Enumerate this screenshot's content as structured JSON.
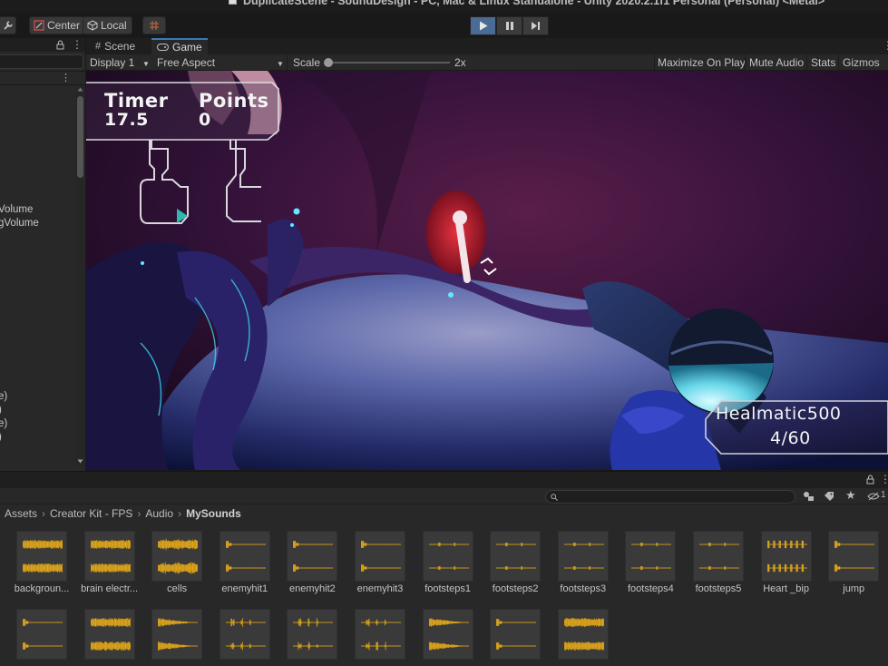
{
  "window": {
    "title": "DuplicateScene - SoundDesign - PC, Mac & Linux Standalone - Unity 2020.2.1f1 Personal (Personal) <Metal>"
  },
  "toolbar": {
    "pivot_label": "Center",
    "space_label": "Local"
  },
  "hierarchy": {
    "rows": [
      "Volume",
      "gVolume",
      "e)",
      ")",
      "e)",
      ")"
    ]
  },
  "tabs": [
    {
      "label": "Scene",
      "icon": "grid-icon",
      "active": false
    },
    {
      "label": "Game",
      "icon": "gamepad-icon",
      "active": true
    }
  ],
  "game_toolbar": {
    "display": "Display 1",
    "aspect": "Free Aspect",
    "scale_label": "Scale",
    "scale_value": "2x",
    "scale_slider_fraction": 0.0,
    "maximize": "Maximize On Play",
    "mute": "Mute Audio",
    "stats": "Stats",
    "gizmos": "Gizmos"
  },
  "hud": {
    "timer_label": "Timer",
    "timer_value": "17.5",
    "points_label": "Points",
    "points_value": "0",
    "weapon_name": "Healmatic500",
    "ammo": "4/60"
  },
  "project": {
    "breadcrumb": [
      "Assets",
      "Creator Kit - FPS",
      "Audio",
      "MySounds"
    ],
    "assets": [
      {
        "name": "backgroun...",
        "wave": "dense"
      },
      {
        "name": "brain electr...",
        "wave": "dense"
      },
      {
        "name": "cells",
        "wave": "burst"
      },
      {
        "name": "enemyhit1",
        "wave": "spike"
      },
      {
        "name": "enemyhit2",
        "wave": "spike"
      },
      {
        "name": "enemyhit3",
        "wave": "spike"
      },
      {
        "name": "footsteps1",
        "wave": "tick"
      },
      {
        "name": "footsteps2",
        "wave": "tick"
      },
      {
        "name": "footsteps3",
        "wave": "tick"
      },
      {
        "name": "footsteps4",
        "wave": "tick"
      },
      {
        "name": "footsteps5",
        "wave": "tick"
      },
      {
        "name": "Heart _bip",
        "wave": "pulses"
      },
      {
        "name": "jump",
        "wave": "spike"
      },
      {
        "name": "",
        "wave": "spike"
      },
      {
        "name": "",
        "wave": "dense"
      },
      {
        "name": "",
        "wave": "fade"
      },
      {
        "name": "",
        "wave": "bursts"
      },
      {
        "name": "",
        "wave": "bursts"
      },
      {
        "name": "",
        "wave": "bursts"
      },
      {
        "name": "",
        "wave": "fade"
      },
      {
        "name": "",
        "wave": "spike"
      },
      {
        "name": "",
        "wave": "dense"
      }
    ]
  },
  "colors": {
    "waveform": "#e0a61a",
    "accent": "#3a79bb",
    "play_active": "#4a6b96"
  }
}
